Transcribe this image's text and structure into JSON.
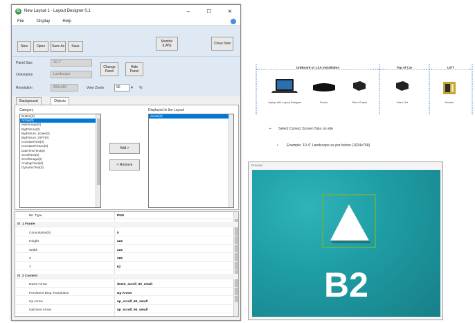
{
  "window": {
    "title": "New Layout 1 - Layout Designer 0.1",
    "app_icon": "app-icon",
    "controls": {
      "minimize": "–",
      "maximize": "☐",
      "close": "✕"
    }
  },
  "menu": [
    "File",
    "Display",
    "Help"
  ],
  "toolbar": {
    "new": "New",
    "open": "Open",
    "save_as": "Save As",
    "save": "Save",
    "monitor": "Monitor (LAN)",
    "close": "Close Now"
  },
  "panel": {
    "panel_size_label": "Panel Size",
    "panel_size_value": "10.1\"",
    "orientation_label": "Orientation",
    "orientation_value": "Landscape",
    "resolution_label": "Resolution",
    "resolution_value": "800x480",
    "change_panel": "Change Panel",
    "hide_panel": "Hide Panel",
    "view_zoom_label": "View Zoom",
    "view_zoom_value": "50",
    "view_zoom_unit": "%"
  },
  "tabs": [
    "Background",
    "Objects"
  ],
  "objects": {
    "category_label": "Category",
    "categories": [
      "Button(0)",
      "Arrow(0)",
      "MainImage(0)",
      "BigPicture(0)",
      "BigPicture_Scale(0)",
      "BigPicture_DIFF(0)",
      "ConstantText(0)",
      "ConstantPicture(0)",
      "DateTimeText(0)",
      "ScrollText(0)",
      "ScrollImage(0)",
      "AnalogClock(0)",
      "DynamicText(0)"
    ],
    "selected_category": 1,
    "add_button": "Add >",
    "remove_button": "< Remove",
    "displayed_label": "Displayed in the Layout",
    "displayed": [
      "Arrow(7)"
    ]
  },
  "property_grid": {
    "rows": [
      {
        "type": "row",
        "key": "Bit. Type",
        "value": "PNG"
      },
      {
        "type": "category",
        "key": "1 Frame",
        "value": ""
      },
      {
        "type": "row",
        "key": "Convolution(0)",
        "value": "0"
      },
      {
        "type": "row",
        "key": "Height",
        "value": "222"
      },
      {
        "type": "row",
        "key": "Width",
        "value": "222"
      },
      {
        "type": "row",
        "key": "X",
        "value": "290"
      },
      {
        "type": "row",
        "key": "Y",
        "value": "62"
      },
      {
        "type": "category",
        "key": "2 Content",
        "value": ""
      },
      {
        "type": "row",
        "key": "Down Arrow",
        "value": "down_scroll_50_small"
      },
      {
        "type": "row",
        "key": "Persistent Disp. Resolution",
        "value": "Up Arrow"
      },
      {
        "type": "row",
        "key": "Up Arrow",
        "value": "up_scroll_50_small"
      },
      {
        "type": "row",
        "key": "UpDown Arrow",
        "value": "up_scroll_50_small"
      }
    ]
  },
  "diagram": {
    "sections": [
      {
        "label": "UniBoard or LSA Installation",
        "devices": [
          "Laptop with Layout Designer",
          "Router",
          "Video Output"
        ]
      },
      {
        "label": "Top of Car",
        "devices": [
          "Video Out"
        ]
      },
      {
        "label": "LIFT",
        "devices": [
          "Monitor"
        ]
      }
    ],
    "bullets": [
      "Select Correct Screen Size on site",
      "Example: 10.4\" Landscape as per below (1024x768)"
    ]
  },
  "preview": {
    "title": "Preview",
    "floor_text": "B2",
    "colors": {
      "background": "#1f9ea6",
      "arrow": "#ffffff",
      "frame": "#6fb04a"
    }
  }
}
